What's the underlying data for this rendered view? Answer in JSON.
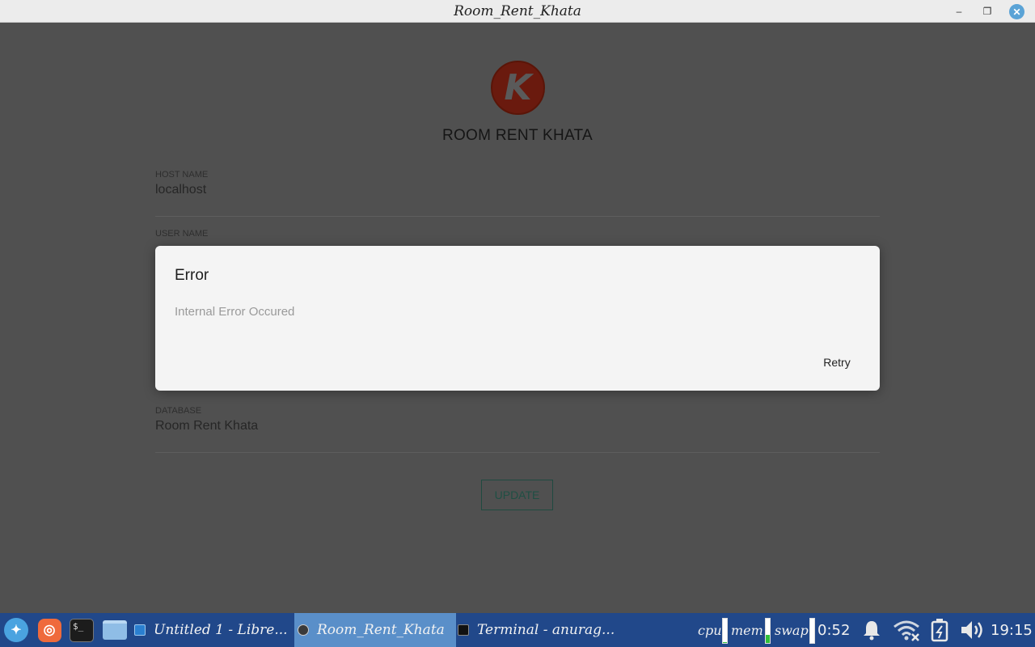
{
  "window": {
    "title": "Room_Rent_Khata",
    "minimize_glyph": "–",
    "maximize_glyph": "❐",
    "close_glyph": "✕"
  },
  "app": {
    "logo_letter": "K",
    "title": "ROOM RENT KHATA",
    "fields": {
      "host": {
        "label": "HOST NAME",
        "value": "localhost"
      },
      "user": {
        "label": "USER NAME",
        "value": ""
      },
      "database": {
        "label": "DATABASE",
        "value": "Room Rent Khata"
      }
    },
    "update_label": "UPDATE"
  },
  "dialog": {
    "title": "Error",
    "message": "Internal Error Occured",
    "action_label": "Retry"
  },
  "taskbar": {
    "tasks": [
      {
        "label": "Untitled 1 - Libre..."
      },
      {
        "label": "Room_Rent_Khata"
      },
      {
        "label": "Terminal - anurag..."
      }
    ],
    "monitors": {
      "cpu_label": "cpu",
      "mem_label": "mem",
      "swap_label": "swap",
      "cpu_level": 0.05,
      "mem_level": 0.35,
      "swap_level": 0.0
    },
    "battery_time": "0:52",
    "clock": "19:15",
    "colors": {
      "taskbar_bg": "#21488a",
      "active_task_bg": "#5a8fc9",
      "mem_fill": "#2fbf3a",
      "cpu_fill": "#2fbf3a"
    },
    "icons": [
      "app-menu-icon",
      "firefox-icon",
      "terminal-icon",
      "file-manager-icon",
      "notification-bell-icon",
      "wifi-disconnected-icon",
      "battery-icon",
      "volume-icon"
    ]
  }
}
